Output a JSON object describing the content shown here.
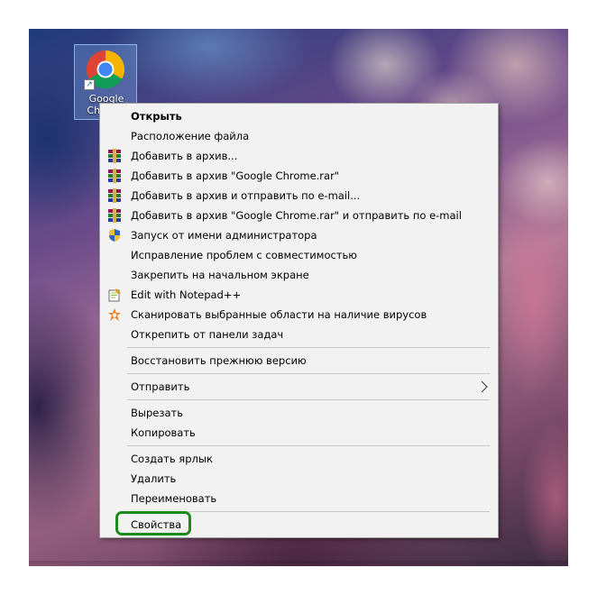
{
  "desktop": {
    "shortcut": {
      "label": "Google Chrome",
      "icon": "chrome-icon",
      "overlay_icon": "shortcut-arrow-icon"
    }
  },
  "context_menu": {
    "items": [
      {
        "label": "Открыть",
        "bold": true,
        "icon": null
      },
      {
        "label": "Расположение файла",
        "icon": null
      },
      {
        "label": "Добавить в архив...",
        "icon": "winrar-icon"
      },
      {
        "label": "Добавить в архив \"Google Chrome.rar\"",
        "icon": "winrar-icon"
      },
      {
        "label": "Добавить в архив и отправить по e-mail...",
        "icon": "winrar-icon"
      },
      {
        "label": "Добавить в архив \"Google Chrome.rar\" и отправить по e-mail",
        "icon": "winrar-icon"
      },
      {
        "label": "Запуск от имени администратора",
        "icon": "uac-shield-icon"
      },
      {
        "label": "Исправление проблем с совместимостью",
        "icon": null
      },
      {
        "label": "Закрепить на начальном экране",
        "icon": null
      },
      {
        "label": "Edit with Notepad++",
        "icon": "notepad-plus-plus-icon"
      },
      {
        "label": "Сканировать выбранные области на наличие вирусов",
        "icon": "avast-icon"
      },
      {
        "label": "Открепить от панели задач",
        "icon": null
      },
      {
        "label": "Восстановить прежнюю версию",
        "icon": null
      },
      {
        "label": "Отправить",
        "icon": null,
        "submenu": true
      },
      {
        "label": "Вырезать",
        "icon": null
      },
      {
        "label": "Копировать",
        "icon": null
      },
      {
        "label": "Создать ярлык",
        "icon": null
      },
      {
        "label": "Удалить",
        "icon": null
      },
      {
        "label": "Переименовать",
        "icon": null
      },
      {
        "label": "Свойства",
        "icon": null,
        "highlighted": true
      }
    ]
  },
  "colors": {
    "menu_background": "#f2f2f2",
    "menu_border": "#a0a0a0",
    "separator": "#c8c8c8",
    "highlight_outline": "#1e8a1e"
  }
}
